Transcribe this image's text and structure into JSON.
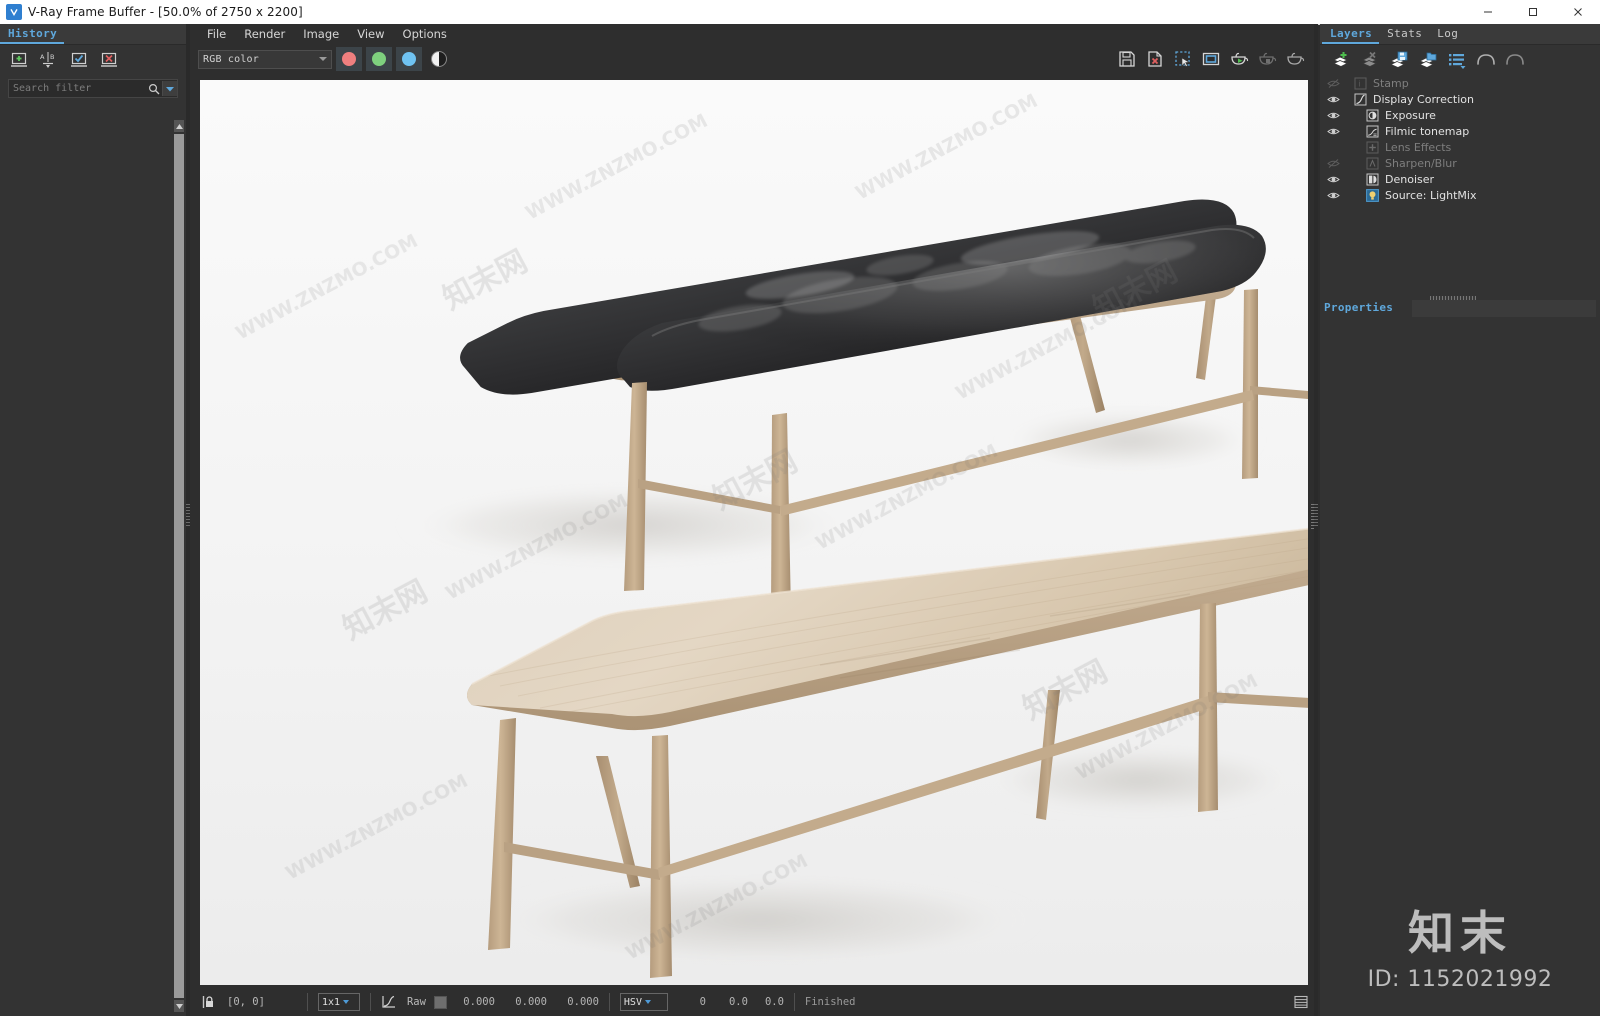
{
  "window": {
    "title": "V-Ray Frame Buffer - [50.0% of 2750 x 2200]",
    "app_icon": "vray-logo-icon",
    "controls": {
      "minimize": "—",
      "maximize": "☐",
      "close": "✕"
    }
  },
  "history_panel": {
    "tab": "History",
    "toolbar": [
      {
        "name": "save-to-history-button",
        "icon": "save-plus-icon"
      },
      {
        "name": "compare-ab-button",
        "icon": "ab-compare-icon"
      },
      {
        "name": "load-from-history-button",
        "icon": "check-load-icon"
      },
      {
        "name": "delete-history-button",
        "icon": "delete-x-icon"
      }
    ],
    "search": {
      "placeholder": "Search filter",
      "value": ""
    }
  },
  "menubar": {
    "items": [
      "File",
      "Render",
      "Image",
      "View",
      "Options"
    ]
  },
  "center_toolbar": {
    "channel_select": {
      "value": "RGB color"
    },
    "channel_buttons": [
      {
        "name": "red-channel-button",
        "color": "#ef7f7f"
      },
      {
        "name": "green-channel-button",
        "color": "#7ed07e"
      },
      {
        "name": "blue-channel-button",
        "color": "#6fc3f2"
      },
      {
        "name": "alpha-channel-button",
        "color": "#f0f0f0"
      }
    ],
    "right_buttons": [
      {
        "name": "save-image-button",
        "icon": "floppy-save-icon"
      },
      {
        "name": "clear-image-button",
        "icon": "file-delete-icon"
      },
      {
        "name": "render-region-button",
        "icon": "marquee-select-icon"
      },
      {
        "name": "fit-to-view-button",
        "icon": "fit-frame-icon"
      },
      {
        "name": "start-render-button",
        "icon": "teapot-play-icon"
      },
      {
        "name": "stop-render-button",
        "icon": "teapot-stop-icon"
      },
      {
        "name": "follow-mouse-button",
        "icon": "teapot-icon"
      }
    ]
  },
  "render_view": {
    "watermark_cn": "知末网",
    "watermark_en": "WWW.ZNZMO.COM",
    "subject": "two wooden benches, one with black leather cushion",
    "background": "#f4f4f4"
  },
  "statusbar": {
    "pixel_lock_icon": "lock-pixel-icon",
    "coordinates": "[0,  0]",
    "sample_size": "1x1",
    "curve_icon": "color-curve-icon",
    "raw_label": "Raw",
    "raw_swatch": "#6e6e6e",
    "raw_values": [
      "0.000",
      "0.000",
      "0.000"
    ],
    "color_mode": "HSV",
    "hsv_values": [
      "0",
      "0.0",
      "0.0"
    ],
    "render_status": "Finished",
    "bottom_right_icon": "layout-toggle-icon"
  },
  "layers_panel": {
    "tabs": [
      {
        "label": "Layers",
        "active": true
      },
      {
        "label": "Stats",
        "active": false
      },
      {
        "label": "Log",
        "active": false
      }
    ],
    "toolbar": [
      {
        "name": "add-layer-button",
        "icon": "layer-add-icon"
      },
      {
        "name": "delete-layer-button",
        "icon": "layer-delete-icon"
      },
      {
        "name": "save-layers-button",
        "icon": "layer-save-icon"
      },
      {
        "name": "load-layers-button",
        "icon": "layer-load-icon"
      },
      {
        "name": "layer-presets-button",
        "icon": "list-menu-icon"
      },
      {
        "name": "undo-button",
        "icon": "undo-arrow-icon"
      },
      {
        "name": "redo-button",
        "icon": "redo-arrow-icon"
      }
    ],
    "layers": [
      {
        "label": "Stamp",
        "icon": "stamp-icon",
        "visible": false,
        "enabled": false,
        "indent": 0
      },
      {
        "label": "Display Correction",
        "icon": "curve-icon",
        "visible": true,
        "enabled": true,
        "indent": 0
      },
      {
        "label": "Exposure",
        "icon": "exposure-icon",
        "visible": true,
        "enabled": true,
        "indent": 1
      },
      {
        "label": "Filmic tonemap",
        "icon": "filmic-icon",
        "visible": true,
        "enabled": true,
        "indent": 1
      },
      {
        "label": "Lens Effects",
        "icon": "lens-plus-icon",
        "visible": false,
        "enabled": false,
        "indent": 1
      },
      {
        "label": "Sharpen/Blur",
        "icon": "sharpen-icon",
        "visible": false,
        "enabled": false,
        "indent": 1
      },
      {
        "label": "Denoiser",
        "icon": "denoiser-icon",
        "visible": true,
        "enabled": true,
        "indent": 1
      },
      {
        "label": "Source: LightMix",
        "icon": "lightmix-icon",
        "visible": true,
        "enabled": true,
        "indent": 1
      }
    ]
  },
  "properties_panel": {
    "tab": "Properties",
    "field_value": ""
  },
  "overlay_watermark": {
    "cn": "知末",
    "id": "ID: 1152021992"
  },
  "colors": {
    "accent": "#5fa8dc",
    "panel_bg": "#333333",
    "canvas_bg": "#2e2e2e",
    "text": "#e2e2e2"
  }
}
